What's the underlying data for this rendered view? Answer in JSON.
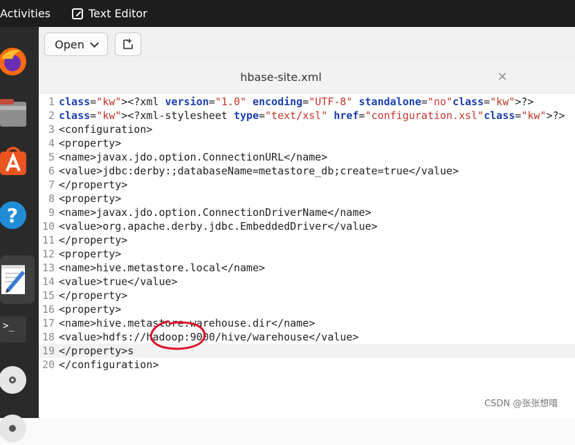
{
  "topbar": {
    "activities": "Activities",
    "app_name": "Text Editor"
  },
  "dock": {
    "items": [
      "firefox-icon",
      "files-icon",
      "software-store-icon",
      "help-icon",
      "text-editor-icon",
      "terminal-icon",
      "disc-icon",
      "disc-icon"
    ]
  },
  "toolbar": {
    "open_label": "Open"
  },
  "tab": {
    "title": "hbase-site.xml",
    "close": "×"
  },
  "editor": {
    "current_line": 19,
    "lines": [
      {
        "n": "1",
        "text": "<?xml version=\"1.0\" encoding=\"UTF-8\" standalone=\"no\"?>"
      },
      {
        "n": "2",
        "text": "<?xml-stylesheet type=\"text/xsl\" href=\"configuration.xsl\"?>"
      },
      {
        "n": "3",
        "text": "<configuration>"
      },
      {
        "n": "4",
        "text": "<property>"
      },
      {
        "n": "5",
        "text": "<name>javax.jdo.option.ConnectionURL</name>"
      },
      {
        "n": "6",
        "text": "<value>jdbc:derby:;databaseName=metastore_db;create=true</value>"
      },
      {
        "n": "7",
        "text": "</property>"
      },
      {
        "n": "8",
        "text": "<property>"
      },
      {
        "n": "9",
        "text": "<name>javax.jdo.option.ConnectionDriverName</name>"
      },
      {
        "n": "10",
        "text": "<value>org.apache.derby.jdbc.EmbeddedDriver</value>"
      },
      {
        "n": "11",
        "text": "</property>"
      },
      {
        "n": "12",
        "text": "<property>"
      },
      {
        "n": "13",
        "text": "<name>hive.metastore.local</name>"
      },
      {
        "n": "14",
        "text": "<value>true</value>"
      },
      {
        "n": "15",
        "text": "</property>"
      },
      {
        "n": "16",
        "text": "<property>"
      },
      {
        "n": "17",
        "text": "<name>hive.metastore.warehouse.dir</name>"
      },
      {
        "n": "18",
        "text": "<value>hdfs://hadoop:9000/hive/warehouse</value>"
      },
      {
        "n": "19",
        "text": "</property>s"
      },
      {
        "n": "20",
        "text": "</configuration>"
      }
    ]
  },
  "watermark": "CSDN @张张想嘻",
  "colors": {
    "annotation": "#e0132b",
    "keyword": "#aa6600",
    "attribute": "#1b3fb0",
    "string": "#c3342c"
  }
}
